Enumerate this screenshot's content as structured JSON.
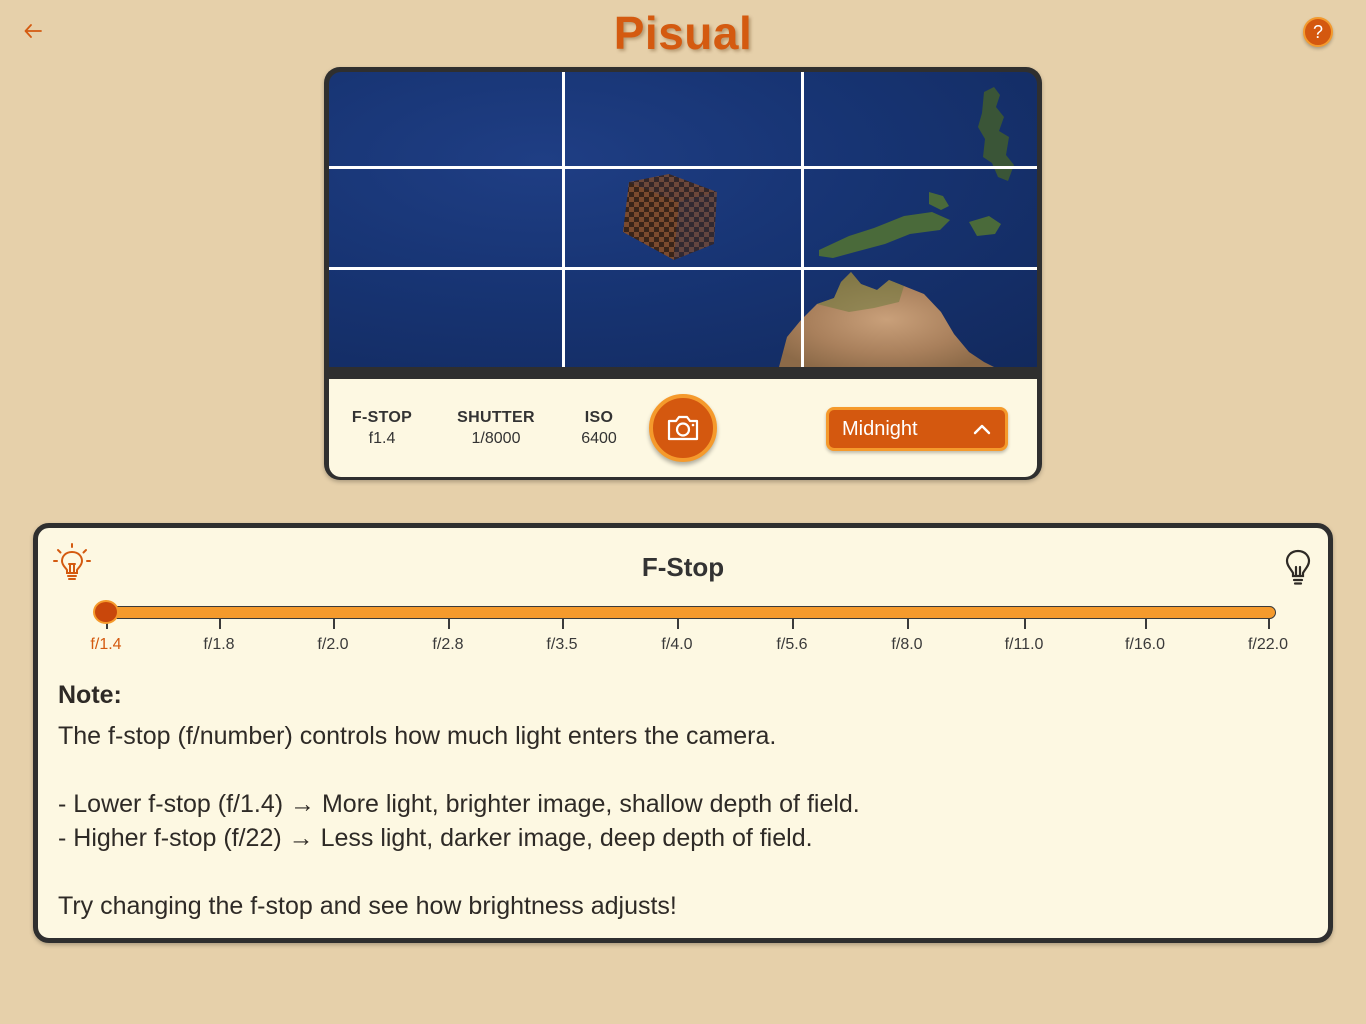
{
  "app": {
    "title": "Pisual",
    "help_label": "?"
  },
  "camera": {
    "settings": [
      {
        "label": "F-STOP",
        "value": "f1.4"
      },
      {
        "label": "SHUTTER",
        "value": "1/8000"
      },
      {
        "label": "ISO",
        "value": "6400"
      }
    ],
    "preset": {
      "selected": "Midnight"
    }
  },
  "fstop_panel": {
    "title": "F-Stop",
    "stops": [
      "f/1.4",
      "f/1.8",
      "f/2.0",
      "f/2.8",
      "f/3.5",
      "f/4.0",
      "f/5.6",
      "f/8.0",
      "f/11.0",
      "f/16.0",
      "f/22.0"
    ],
    "selected_index": 0,
    "note": {
      "heading": "Note:",
      "line1": "The f-stop (f/number) controls how much light enters the camera.",
      "line2": "- Lower f-stop (f/1.4) → More light, brighter image, shallow depth of field.",
      "line3": "- Higher f-stop (f/22) → Less light, darker image, deep depth of field.",
      "line4": "Try changing the f-stop and see how brightness adjusts!"
    }
  },
  "colors": {
    "accent": "#d4580f",
    "accent_light": "#f59a2c",
    "background": "#e6d0aa",
    "panel": "#fdf8e2"
  }
}
